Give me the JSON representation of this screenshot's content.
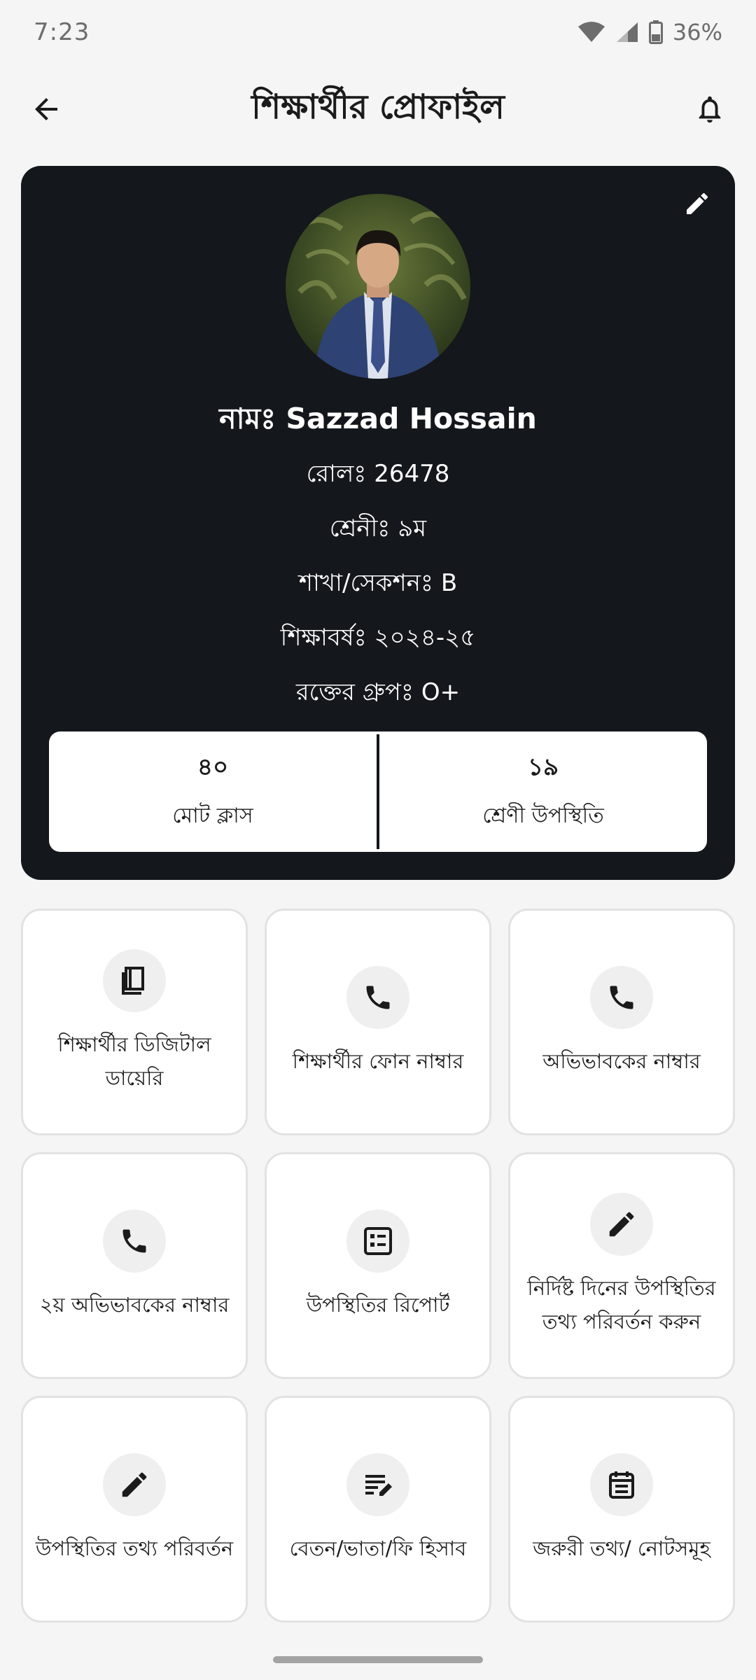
{
  "status_bar": {
    "time": "7:23",
    "battery": "36%",
    "icons": [
      "wifi-icon",
      "cell-signal-icon",
      "battery-icon"
    ]
  },
  "app_bar": {
    "title": "শিক্ষার্থীর প্রোফাইল",
    "back_icon": "arrow-left-icon",
    "notification_icon": "bell-icon"
  },
  "profile": {
    "edit_icon": "pencil-icon",
    "name": "নামঃ Sazzad Hossain",
    "roll": "রোলঃ 26478",
    "class": "শ্রেনীঃ ৯ম",
    "section": "শাখা/সেকশনঃ B",
    "session": "শিক্ষাবর্ষঃ ২০২৪-২৫",
    "blood_group": "রক্তের গ্রুপঃ O+",
    "card_color": "#14171b"
  },
  "stats": {
    "total_classes": {
      "value": "৪০",
      "label": "মোট ক্লাস"
    },
    "attendance": {
      "value": "১৯",
      "label": "শ্রেণী উপস্থিতি"
    }
  },
  "menu": {
    "items": [
      {
        "label": "শিক্ষার্থীর ডিজিটাল ডায়েরি",
        "icon": "book-icon"
      },
      {
        "label": "শিক্ষার্থীর ফোন নাম্বার",
        "icon": "phone-icon"
      },
      {
        "label": "অভিভাবকের নাম্বার",
        "icon": "phone-icon"
      },
      {
        "label": "২য় অভিভাবকের নাম্বার",
        "icon": "phone-icon"
      },
      {
        "label": "উপস্থিতির রিপোর্ট",
        "icon": "list-report-icon"
      },
      {
        "label": "নির্দিষ্ট দিনের উপস্থিতির তথ্য পরিবর্তন করুন",
        "icon": "pencil-icon"
      },
      {
        "label": "উপস্থিতির তথ্য পরিবর্তন",
        "icon": "pencil-icon"
      },
      {
        "label": "বেতন/ভাতা/ফি হিসাব",
        "icon": "edit-note-icon"
      },
      {
        "label": "জরুরী তথ্য/ নোটসমূহ",
        "icon": "calendar-note-icon"
      }
    ]
  }
}
